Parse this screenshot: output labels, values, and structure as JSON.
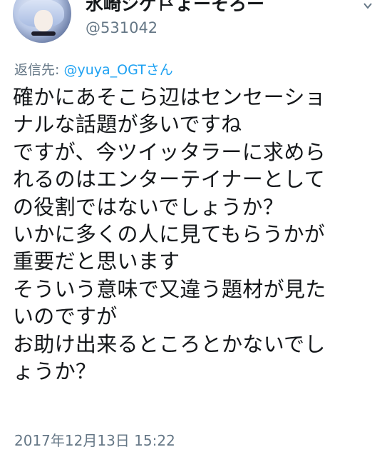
{
  "author": {
    "display_name": "氷崎シゲ",
    "display_name_suffix": "ょーそろー",
    "handle": "@531042"
  },
  "reply": {
    "prefix": "返信先: ",
    "mention": "@yuya_OGT",
    "suffix": "さん"
  },
  "tweet": {
    "lines": [
      "確かにあそこら辺はセンセーショ",
      "ナルな話題が多いですね",
      "ですが、今ツイッタラーに求めら",
      "れるのはエンターテイナーとして",
      "の役割ではないでしょうか？",
      "いかに多くの人に見てもらうかが",
      "重要だと思います",
      "そういう意味で又違う題材が見た",
      "いのですが",
      "お助け出来るところとかないでし",
      "ょうか？"
    ]
  },
  "timestamp": "2017年12月13日 15:22",
  "icons": {
    "caret": "chevron-down-icon",
    "flag": "flag-icon",
    "avatar": "avatar"
  },
  "colors": {
    "text": "#14171a",
    "secondary": "#657786",
    "link": "#1da1f2"
  }
}
